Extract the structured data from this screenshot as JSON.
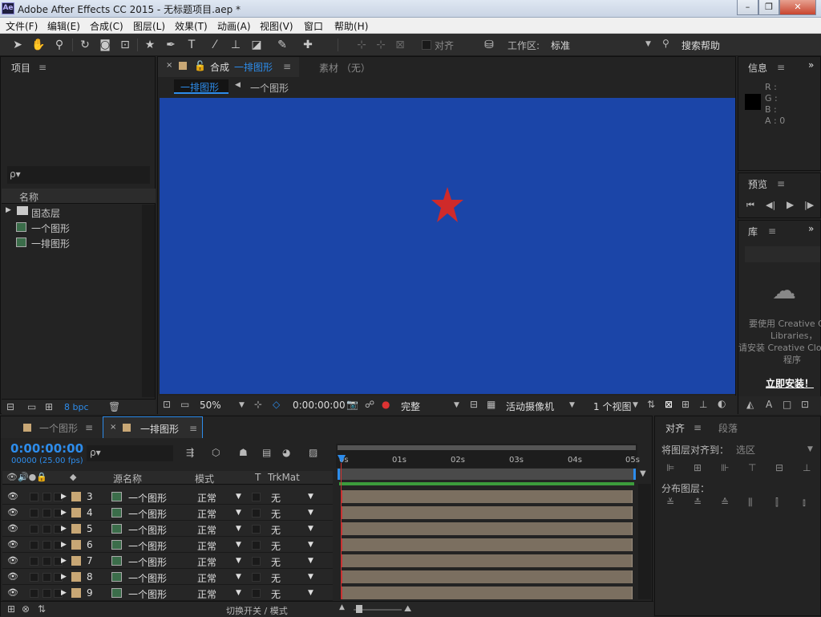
{
  "window": {
    "title": "Adobe After Effects CC 2015 - 无标题项目.aep *",
    "logo": "Ae",
    "minimize": "–",
    "restore": "❐",
    "close": "✕"
  },
  "menu": [
    "文件(F)",
    "编辑(E)",
    "合成(C)",
    "图层(L)",
    "效果(T)",
    "动画(A)",
    "视图(V)",
    "窗口",
    "帮助(H)"
  ],
  "toolbar": {
    "snap_label": "对齐",
    "workspace_label": "工作区:",
    "workspace_value": "标准",
    "search_help": "搜索帮助"
  },
  "project": {
    "title": "项目",
    "search_placeholder": "ρ▾",
    "column_name": "名称",
    "items": [
      {
        "label": "固态层",
        "type": "folder-icon"
      },
      {
        "label": "一个图形",
        "type": "composition-icon"
      },
      {
        "label": "一排图形",
        "type": "composition-icon"
      }
    ],
    "bpc": "8 bpc"
  },
  "comp_panel": {
    "tab_label": "合成",
    "tab_comp": "一排图形",
    "footage_tab": "素材 （无）",
    "breadcrumb_active": "一排图形",
    "breadcrumb_next": "一个图形",
    "canvas_color": "#1b45a8",
    "star_color": "#cf2a2a"
  },
  "viewer_bar": {
    "zoom": "50%",
    "timecode": "0:00:00:00",
    "resolution": "完整",
    "camera": "活动摄像机",
    "views": "1 个视图"
  },
  "info": {
    "title": "信息",
    "r": "R :",
    "g": "G :",
    "b": "B :",
    "a": "A : 0"
  },
  "preview": {
    "title": "预览"
  },
  "library": {
    "title": "库",
    "msg1": "要使用 Creative Cl",
    "msg2": "Libraries，",
    "msg3": "请安装 Creative Clou",
    "msg4": "程序",
    "install": "立即安装！"
  },
  "timeline": {
    "tab1": "一个图形",
    "tab2": "一排图形",
    "timecode": "0:00:00:00",
    "fps": "00000 (25.00 fps)",
    "col_source": "源名称",
    "col_mode": "模式",
    "col_t": "T",
    "col_trkmat": "TrkMat",
    "ruler": [
      "0s",
      "01s",
      "02s",
      "03s",
      "04s",
      "05s"
    ],
    "toggle_label": "切换开关 / 模式",
    "layers": [
      {
        "num": "3",
        "name": "一个图形",
        "mode": "正常",
        "trk": "无"
      },
      {
        "num": "4",
        "name": "一个图形",
        "mode": "正常",
        "trk": "无"
      },
      {
        "num": "5",
        "name": "一个图形",
        "mode": "正常",
        "trk": "无"
      },
      {
        "num": "6",
        "name": "一个图形",
        "mode": "正常",
        "trk": "无"
      },
      {
        "num": "7",
        "name": "一个图形",
        "mode": "正常",
        "trk": "无"
      },
      {
        "num": "8",
        "name": "一个图形",
        "mode": "正常",
        "trk": "无"
      },
      {
        "num": "9",
        "name": "一个图形",
        "mode": "正常",
        "trk": "无"
      }
    ]
  },
  "align": {
    "tab1": "对齐",
    "tab2": "段落",
    "align_to_label": "将图层对齐到：",
    "align_to_value": "选区",
    "distribute_label": "分布图层："
  }
}
